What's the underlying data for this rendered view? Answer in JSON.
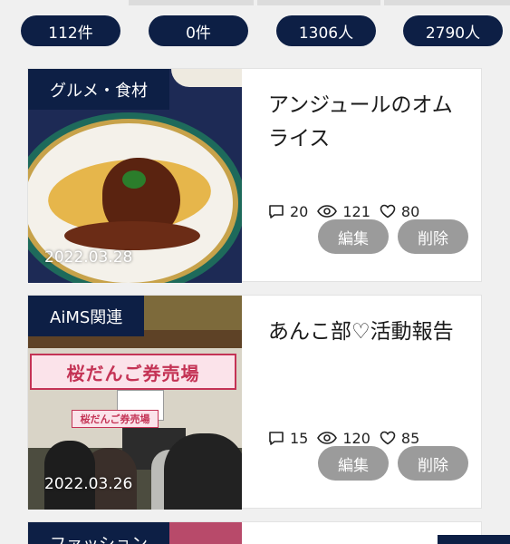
{
  "stats": [
    {
      "label": "112件"
    },
    {
      "label": "0件"
    },
    {
      "label": "1306人"
    },
    {
      "label": "2790人"
    }
  ],
  "articles": [
    {
      "category": "グルメ・食材",
      "date": "2022.03.28",
      "title": "アンジュールのオムライス",
      "comments": "20",
      "views": "121",
      "likes": "80",
      "edit_label": "編集",
      "delete_label": "削除"
    },
    {
      "category": "AiMS関連",
      "date": "2022.03.26",
      "title": "あんこ部♡活動報告",
      "comments": "15",
      "views": "120",
      "likes": "85",
      "edit_label": "編集",
      "delete_label": "削除",
      "photo_sign_text": "桜だんご券売場",
      "photo_small_sign_text": "桜だんご券売場"
    },
    {
      "category": "ファッション"
    }
  ],
  "colors": {
    "navy": "#0d1f45",
    "gray_button": "#9b9b9b",
    "background": "#f0f0f0"
  },
  "icons": {
    "comments": "comment-bubble-icon",
    "views": "eye-icon",
    "likes": "heart-icon"
  }
}
